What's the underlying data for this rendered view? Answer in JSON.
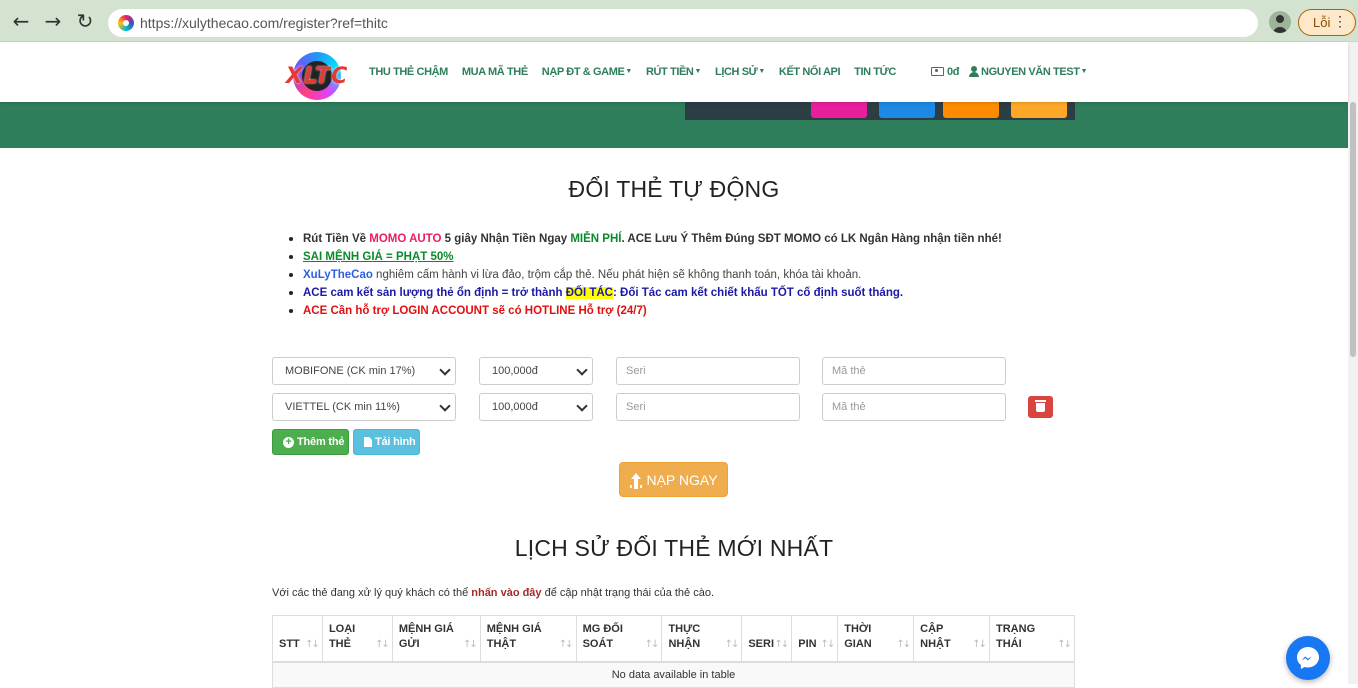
{
  "browser": {
    "url": "https://xulythecao.com/register?ref=thitc",
    "error_chip": "Lỗi"
  },
  "navbar": {
    "logo_text": "XLTC",
    "menu": [
      {
        "label": "THU THẺ CHẬM",
        "dropdown": false
      },
      {
        "label": "MUA MÃ THẺ",
        "dropdown": false
      },
      {
        "label": "NẠP ĐT & GAME",
        "dropdown": true
      },
      {
        "label": "RÚT TIỀN",
        "dropdown": true
      },
      {
        "label": "LỊCH SỬ",
        "dropdown": true
      },
      {
        "label": "KẾT NỐI API",
        "dropdown": false
      },
      {
        "label": "TIN TỨC",
        "dropdown": false
      }
    ],
    "balance": "0đ",
    "user": "NGUYEN VĂN TEST"
  },
  "main": {
    "title": "ĐỔI THẺ TỰ ĐỘNG",
    "notices": {
      "n1_a": "Rút Tiền Về ",
      "n1_momo": "MOMO AUTO",
      "n1_b": " 5 giây Nhận Tiền Ngay ",
      "n1_free": "MIỄN PHÍ",
      "n1_c": ". ACE Lưu Ý Thêm Đúng SĐT MOMO có LK Ngân Hàng nhận tiền nhé!",
      "n2": "SAI MỆNH GIÁ = PHẠT 50%",
      "n3_brand": "XuLyTheCao",
      "n3_text": " nghiêm cấm hành vi lừa đảo, trộm cắp thẻ. Nếu phát hiện sẽ không thanh toán, khóa tài khoản.",
      "n4_a": "ACE cam kết sản lượng thẻ ổn định = trở thành ",
      "n4_hl": "ĐỐI TÁC",
      "n4_b": ": Đối Tác cam kết chiết khấu TỐT cố định suốt tháng.",
      "n5": "ACE Cần hỗ trợ LOGIN ACCOUNT sẽ có HOTLINE Hỗ trợ (24/7)"
    },
    "rows": [
      {
        "telco": "MOBIFONE (CK min 17%)",
        "amount": "100,000đ",
        "serial_placeholder": "Seri",
        "code_placeholder": "Mã thẻ"
      },
      {
        "telco": "VIETTEL (CK min 11%)",
        "amount": "100,000đ",
        "serial_placeholder": "Seri",
        "code_placeholder": "Mã thẻ"
      }
    ],
    "add_label": "Thêm thẻ",
    "upload_label": "Tải hình",
    "submit_label": "NẠP NGAY"
  },
  "history": {
    "title": "LỊCH SỬ ĐỔI THẺ MỚI NHẤT",
    "note_a": "Với các thẻ đang xử lý quý khách có thể ",
    "note_link": "nhấn vào đây",
    "note_b": " để cập nhật trạng thái của thẻ cào.",
    "columns": [
      {
        "l1": "STT",
        "l2": ""
      },
      {
        "l1": "LOẠI",
        "l2": "THẺ"
      },
      {
        "l1": "MỆNH GIÁ",
        "l2": "GỬI"
      },
      {
        "l1": "MỆNH GIÁ",
        "l2": "THẬT"
      },
      {
        "l1": "MG ĐỐI",
        "l2": "SOÁT"
      },
      {
        "l1": "THỰC",
        "l2": "NHẬN"
      },
      {
        "l1": "SERI",
        "l2": ""
      },
      {
        "l1": "PIN",
        "l2": ""
      },
      {
        "l1": "THỜI",
        "l2": "GIAN"
      },
      {
        "l1": "CẬP",
        "l2": "NHẬT"
      },
      {
        "l1": "TRẠNG",
        "l2": "THÁI"
      }
    ],
    "empty": "No data available in table"
  },
  "colors": {
    "brand_green": "#2e7d5b",
    "warning": "#f0ad4e",
    "danger": "#d9443f",
    "success": "#4cae4c",
    "info": "#5bc0de"
  }
}
